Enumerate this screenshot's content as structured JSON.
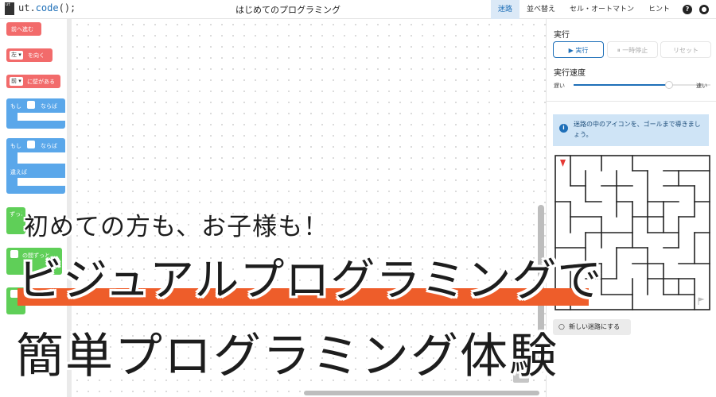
{
  "header": {
    "logo_glyph": "ut",
    "logo_prefix": "ut.",
    "logo_fn": "code",
    "logo_suffix": "();",
    "title": "はじめてのプログラミング",
    "tabs": [
      {
        "label": "迷路",
        "active": true
      },
      {
        "label": "並べ替え",
        "active": false
      },
      {
        "label": "セル・オートマトン",
        "active": false
      },
      {
        "label": "ヒント",
        "active": false
      }
    ],
    "help_icon": "help-icon",
    "github_icon": "github-icon"
  },
  "palette": {
    "move_forward": "前へ進む",
    "turn_dir": "左",
    "turn_suffix": "を向く",
    "wall_dir": "前",
    "wall_suffix": "に壁がある",
    "if_prefix": "もし",
    "if_suffix": "ならば",
    "else_label": "違えば",
    "repeat_prefix": "ずっと",
    "while_label": "の間ずっと"
  },
  "panel": {
    "run_title": "実行",
    "run_button": "▶ 実行",
    "pause_button": "⏸ 一時停止",
    "reset_button": "リセット",
    "speed_title": "実行速度",
    "speed_slow": "遅い",
    "speed_fast": "速い",
    "speed_level": 0.7,
    "info_text": "迷路の中のアイコンを、ゴールまで導きましょう。",
    "new_maze_button": "新しい迷路にする",
    "colors": {
      "accent": "#1e6fb8",
      "start_marker": "#e53935"
    }
  },
  "promo": {
    "line1": "初めての方も、お子様も！",
    "line2": "ビジュアルプログラミングで",
    "line3": "簡単プログラミング体験",
    "bar_color": "#ee5d2a"
  }
}
